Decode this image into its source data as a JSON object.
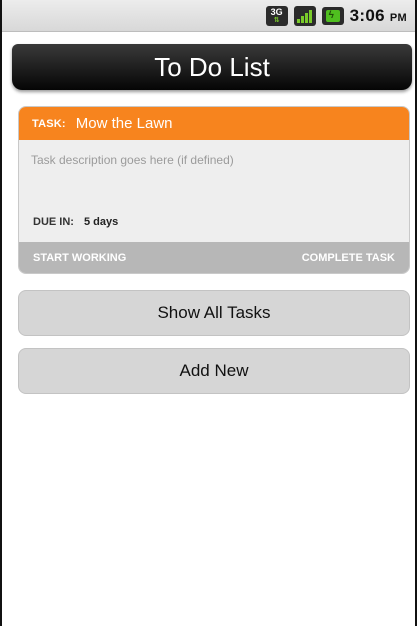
{
  "status_bar": {
    "network_label": "3G",
    "time": "3:06",
    "meridiem": "PM",
    "signal_icon": "signal-icon",
    "battery_icon": "battery-icon",
    "accent_color": "#7acb2a"
  },
  "title_bar": {
    "title": "To Do List"
  },
  "task": {
    "prefix": "TASK:",
    "name": "Mow the Lawn",
    "description": "Task description goes here (if defined)",
    "due_label": "DUE IN:",
    "due_value": "5 days",
    "header_color": "#f7841e",
    "actions": {
      "start": "START WORKING",
      "complete": "COMPLETE TASK"
    }
  },
  "buttons": {
    "show_all": "Show All Tasks",
    "add_new": "Add New"
  }
}
